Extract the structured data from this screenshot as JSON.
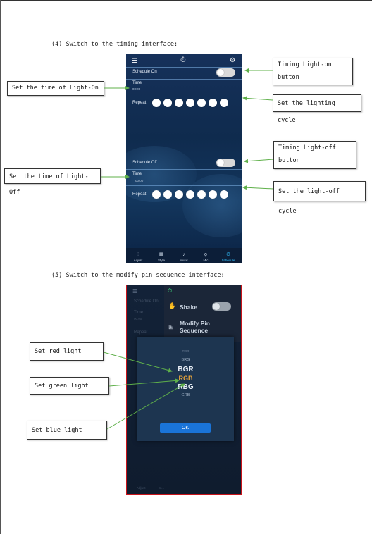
{
  "section4": {
    "heading": "(4) Switch to the timing interface:",
    "phone": {
      "menu_icon": "menu-icon",
      "timer_icon": "timer-icon",
      "settings_icon": "gear-icon",
      "schedule_on_label": "Schedule On",
      "time_label_1": "Time",
      "time_value_1": "00:00",
      "repeat_label_1": "Repeat",
      "schedule_off_label": "Schedule Off",
      "time_label_2": "Time",
      "time_value_2": "00:00",
      "repeat_label_2": "Repeat",
      "nav": [
        {
          "label": "Adjust",
          "icon": "sliders-icon"
        },
        {
          "label": "Style",
          "icon": "grid-icon"
        },
        {
          "label": "Music",
          "icon": "music-note-icon"
        },
        {
          "label": "Mic",
          "icon": "microphone-icon"
        },
        {
          "label": "Schedule",
          "icon": "timer-icon"
        }
      ]
    },
    "callouts": {
      "timing_on_button": "Timing Light-on button",
      "time_light_on": "Set the time of Light-On",
      "lighting_cycle": "Set the lighting cycle",
      "timing_off_button": "Timing Light-off button",
      "time_light_off": "Set the time of Light-Off",
      "light_off_cycle": "Set the light-off cycle"
    }
  },
  "section5": {
    "heading": "(5) Switch to the modify pin sequence interface:",
    "phone": {
      "menu_icon": "menu-icon",
      "timer_icon": "timer-icon",
      "bg_schedule_on": "Schedule On",
      "bg_time": "Time",
      "bg_time_value": "00:00",
      "bg_repeat": "Repeat",
      "shake_label": "Shake",
      "modify_pin_label_line1": "Modify Pin",
      "modify_pin_label_line2": "Sequence",
      "picker": [
        "GBR",
        "BRG",
        "BGR",
        "RGB",
        "RBG",
        "GRB"
      ],
      "selected": "RGB",
      "ok_label": "OK",
      "nav_labels": [
        "Adjust",
        "St..."
      ]
    },
    "callouts": {
      "red": "Set red light",
      "green": "Set green light",
      "blue": "Set blue light"
    },
    "colors": {
      "border": "#c8131a",
      "ok_button": "#1a74d8",
      "selected_text": "#e8a43b",
      "arrow": "#5fb04a"
    }
  }
}
